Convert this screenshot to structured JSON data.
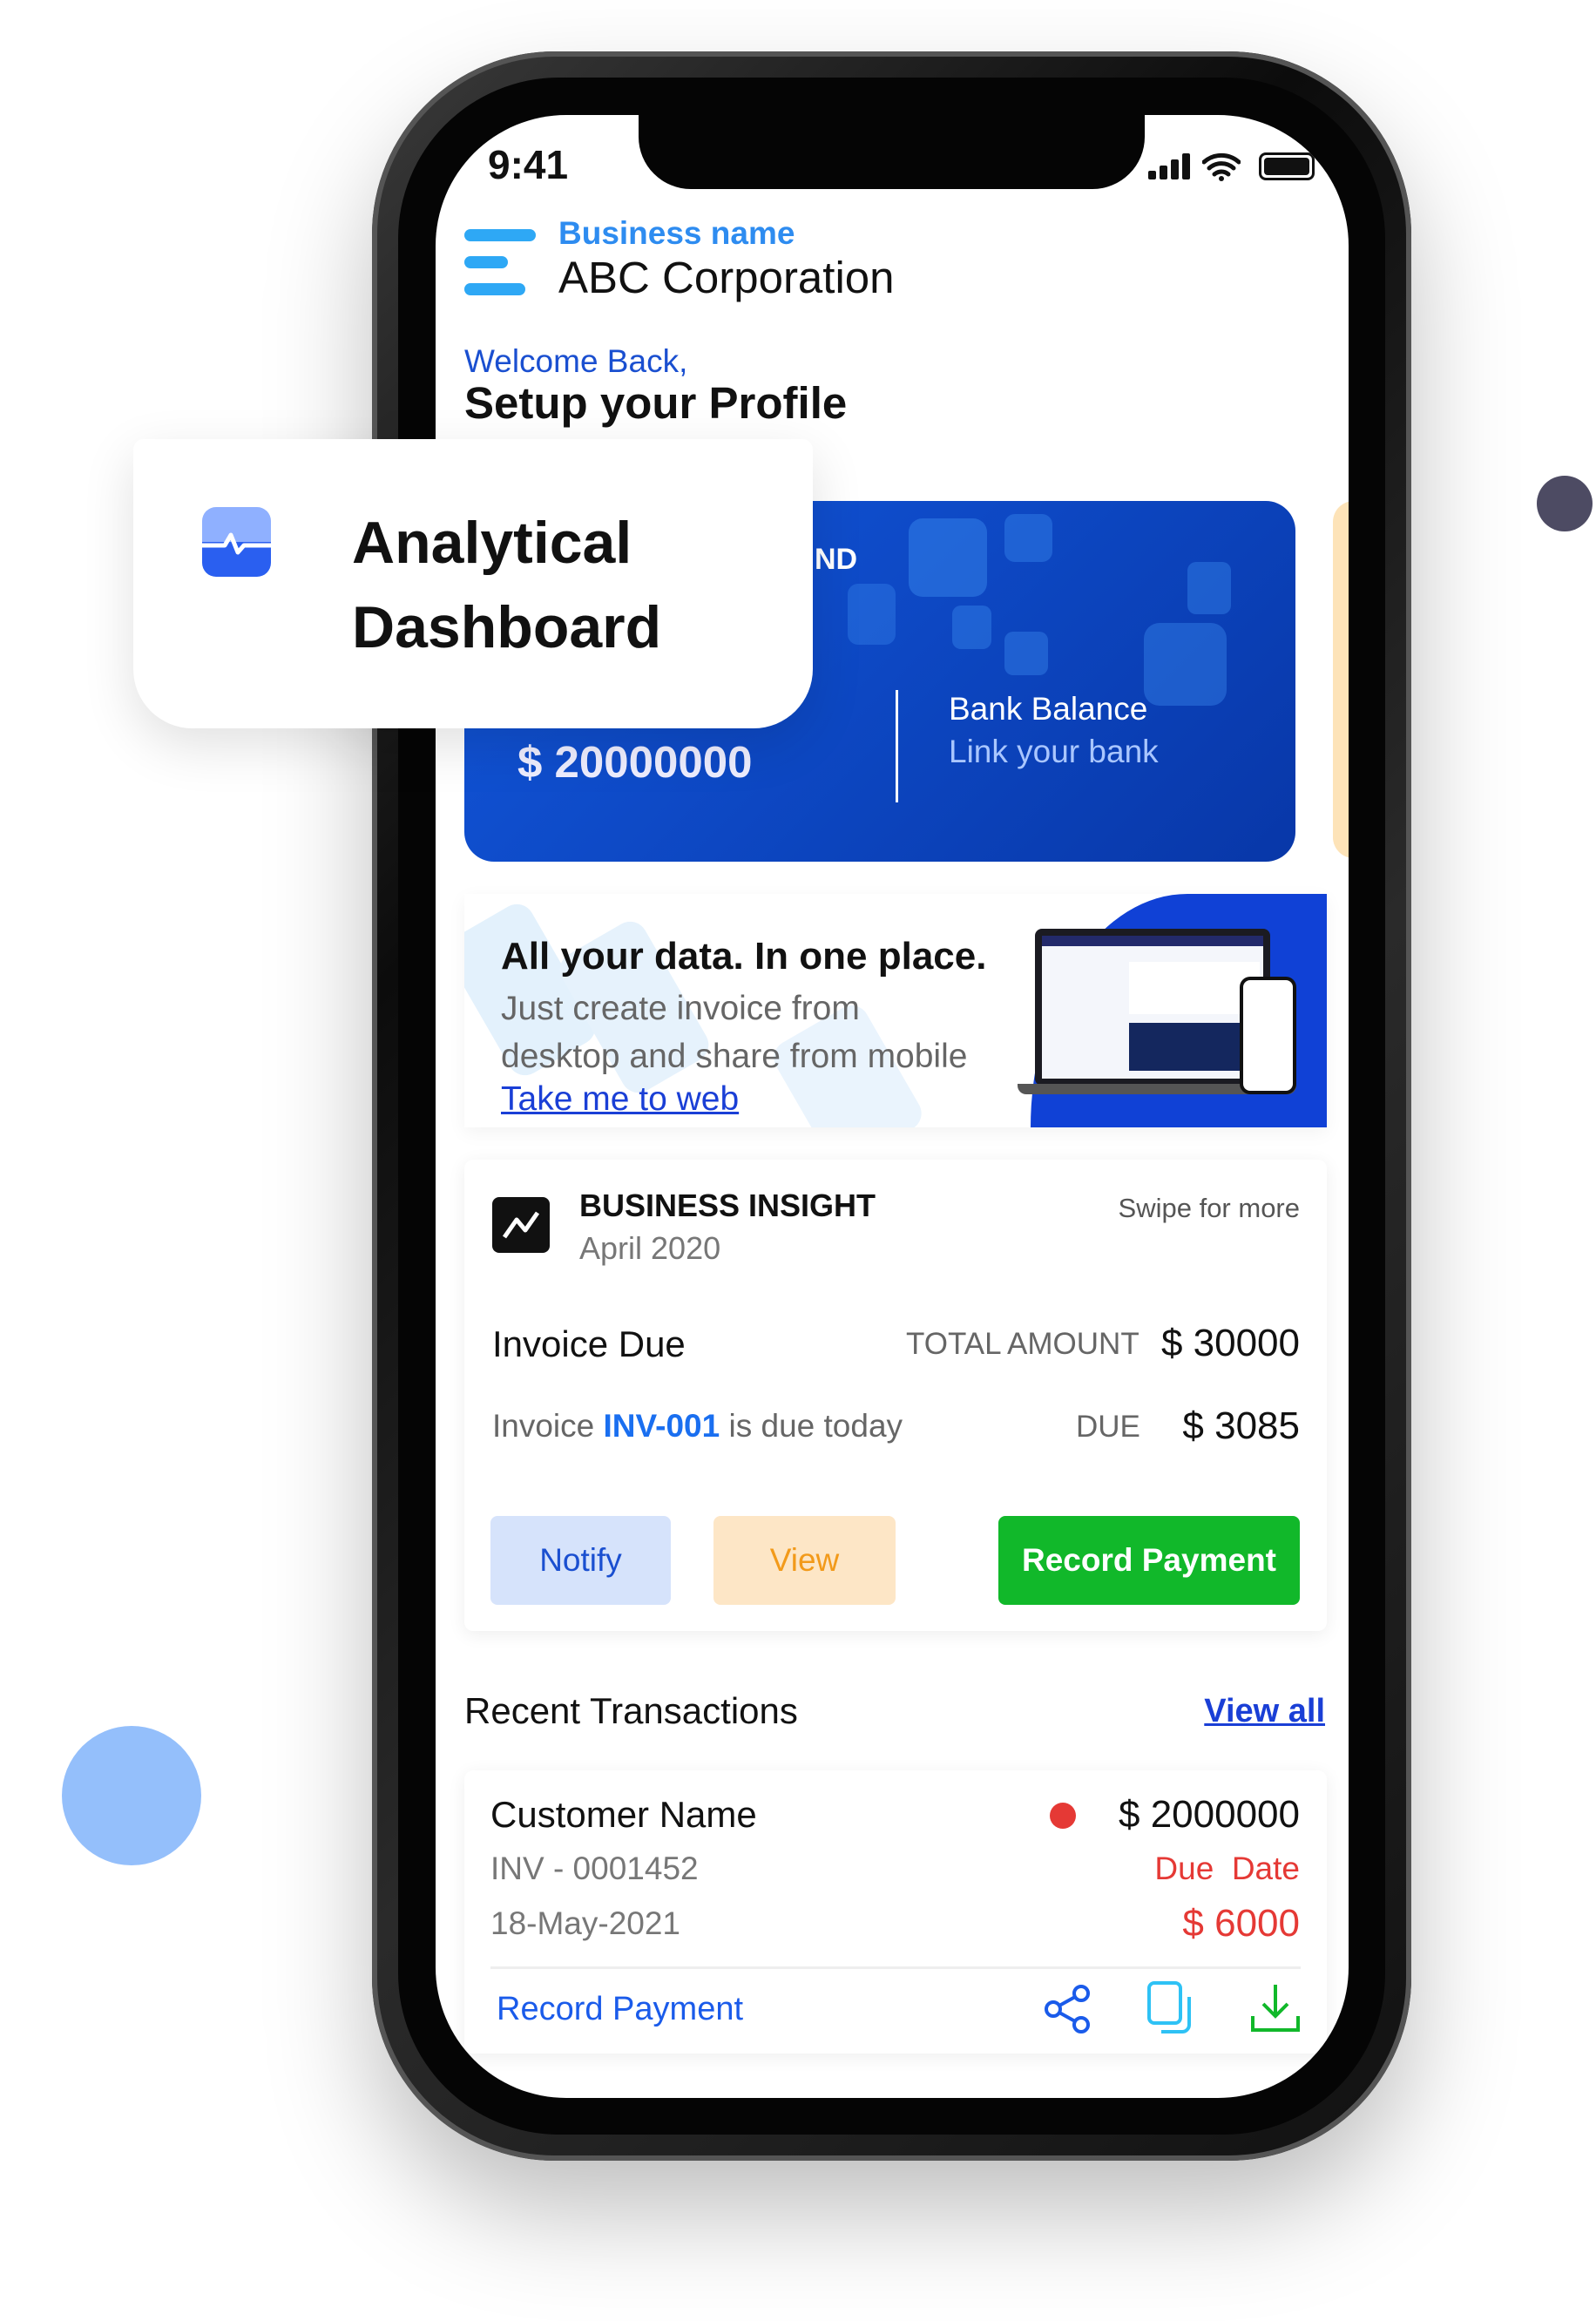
{
  "status_bar": {
    "time": "9:41"
  },
  "header": {
    "label": "Business name",
    "business": "ABC Corporation",
    "welcome": "Welcome Back,",
    "subtitle": "Setup your Profile"
  },
  "balance_card": {
    "partial_label": "ND",
    "amount": "$ 20000000",
    "bank_label": "Bank Balance",
    "bank_link": "Link your bank"
  },
  "popup": {
    "line1": "Analytical",
    "line2": "Dashboard",
    "icon": "pulse-icon"
  },
  "promo": {
    "title": "All your data. In one place.",
    "line1": "Just create invoice from",
    "line2": "desktop and share from mobile",
    "link": "Take me to web"
  },
  "insight": {
    "title": "BUSINESS INSIGHT",
    "period": "April 2020",
    "swipe": "Swipe for more",
    "invoice_due": "Invoice Due",
    "total_label": "TOTAL AMOUNT",
    "total_value": "$ 30000",
    "due_prefix": "Invoice",
    "invoice_id": "INV-001",
    "due_suffix": "is due today",
    "due_label": "DUE",
    "due_value": "$ 3085",
    "buttons": {
      "notify": "Notify",
      "view": "View",
      "record": "Record Payment"
    }
  },
  "recent": {
    "title": "Recent Transactions",
    "view_all": "View all",
    "items": [
      {
        "customer": "Customer Name",
        "invoice": "INV - 0001452",
        "date": "18-May-2021",
        "amount": "$ 2000000",
        "due_label": "Due  Date",
        "due_amount": "$ 6000",
        "action": "Record Payment"
      }
    ]
  },
  "colors": {
    "accent": "#1a5bea",
    "card_blue": "#0c47cf",
    "green": "#11b82a",
    "red": "#e53935",
    "notify_bg": "#d6e3fb",
    "view_bg": "#fde6c6"
  }
}
